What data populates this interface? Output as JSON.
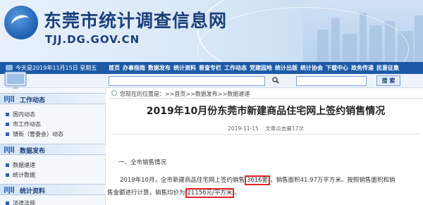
{
  "site": {
    "name": "东莞市统计调查信息网",
    "domain": "TJJ.DG.GOV.CN"
  },
  "nav": {
    "today": "今天是2019年11月15日 星期五",
    "menu": [
      "首页",
      "办事指南",
      "数据发布",
      "统计资料",
      "普查专栏",
      "工作动态",
      "党建园地",
      "统计出版",
      "统计协会",
      "下载中心",
      "政务传递",
      "民意征集"
    ]
  },
  "search": {
    "button_label": "搜 索"
  },
  "sidebar": {
    "sections": [
      {
        "title": "工作动态",
        "items": [
          "国内动态",
          "市工作动态",
          "镇街（管委会）动态"
        ]
      },
      {
        "title": "数据发布",
        "items": [
          "数据速递",
          "统计数据"
        ]
      },
      {
        "title": "统计资料",
        "items": [
          "法律法规"
        ]
      }
    ]
  },
  "breadcrumb": {
    "prefix": "您现在的位置是：",
    "items": [
      "首页",
      "数据发布",
      "数据速递"
    ],
    "sep": ">>"
  },
  "article": {
    "title": "2019年10月份东莞市新建商品住宅网上签约销售情况",
    "date": "2019-11-15",
    "views_label": "文章点击量17次",
    "section1": "一、全市销售情况",
    "para1_a": "2019年10月，全市新建商品住宅网上签约销售",
    "para1_highlight": "3616套",
    "para1_b": "，销售面积41.97万平方米。按照销售面积和销",
    "para2_a": "售金额进行计算，销售均价为",
    "para2_highlight": "21156元/平方米",
    "para2_b": "。"
  },
  "colors": {
    "nav_bg": "#1c5aa7",
    "highlight_box": "#e0262b",
    "brand_text": "#1a3f7a"
  }
}
